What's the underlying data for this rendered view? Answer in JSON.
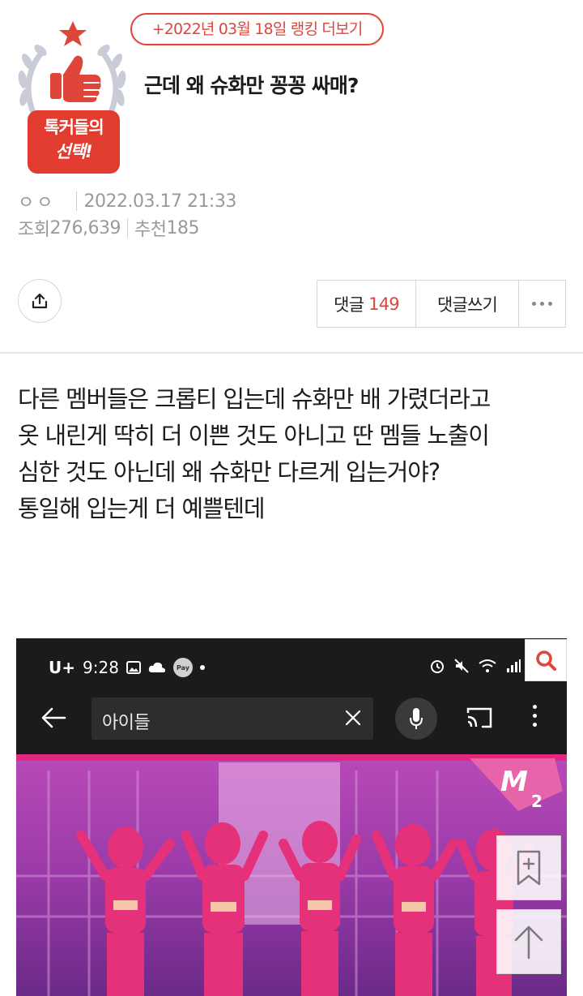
{
  "badge": {
    "line1": "톡커들의",
    "line2": "선택!",
    "accent_color": "#e0453a",
    "icons": [
      "star-icon",
      "thumbs-up-icon",
      "laurel-wreath-icon"
    ]
  },
  "ranking_link": "+2022년 03월 18일 랭킹 더보기",
  "post": {
    "title": "근데 왜 슈화만 꽁꽁 싸매?",
    "author": "ㅇㅇ",
    "datetime": "2022.03.17 21:33",
    "views_label": "조회",
    "views": "276,639",
    "recommend_label": "추천",
    "recommend": "185",
    "body": [
      "다른 멤버들은 크롭티 입는데 슈화만 배 가렸더라고",
      "옷 내린게 딱히 더 이쁜 것도 아니고 딴 멤들 노출이",
      "심한 것도 아닌데 왜 슈화만 다르게 입는거야?",
      "통일해 입는게 더 예쁠텐데"
    ]
  },
  "actions": {
    "comments_label": "댓글",
    "comments_count": "149",
    "write_comment": "댓글쓰기",
    "share_icon": "share-icon",
    "more_icon": "more-dots-icon"
  },
  "embedded_screenshot": {
    "status": {
      "carrier": "U+",
      "time": "9:28",
      "pay": "Pay"
    },
    "search_query": "아이들",
    "icons": [
      "back-arrow-icon",
      "clear-icon",
      "mic-icon",
      "cast-icon",
      "kebab-icon"
    ]
  },
  "floating": {
    "search_icon": "search-icon",
    "bookmark_icon": "bookmark-add-icon",
    "top_icon": "scroll-top-icon"
  }
}
